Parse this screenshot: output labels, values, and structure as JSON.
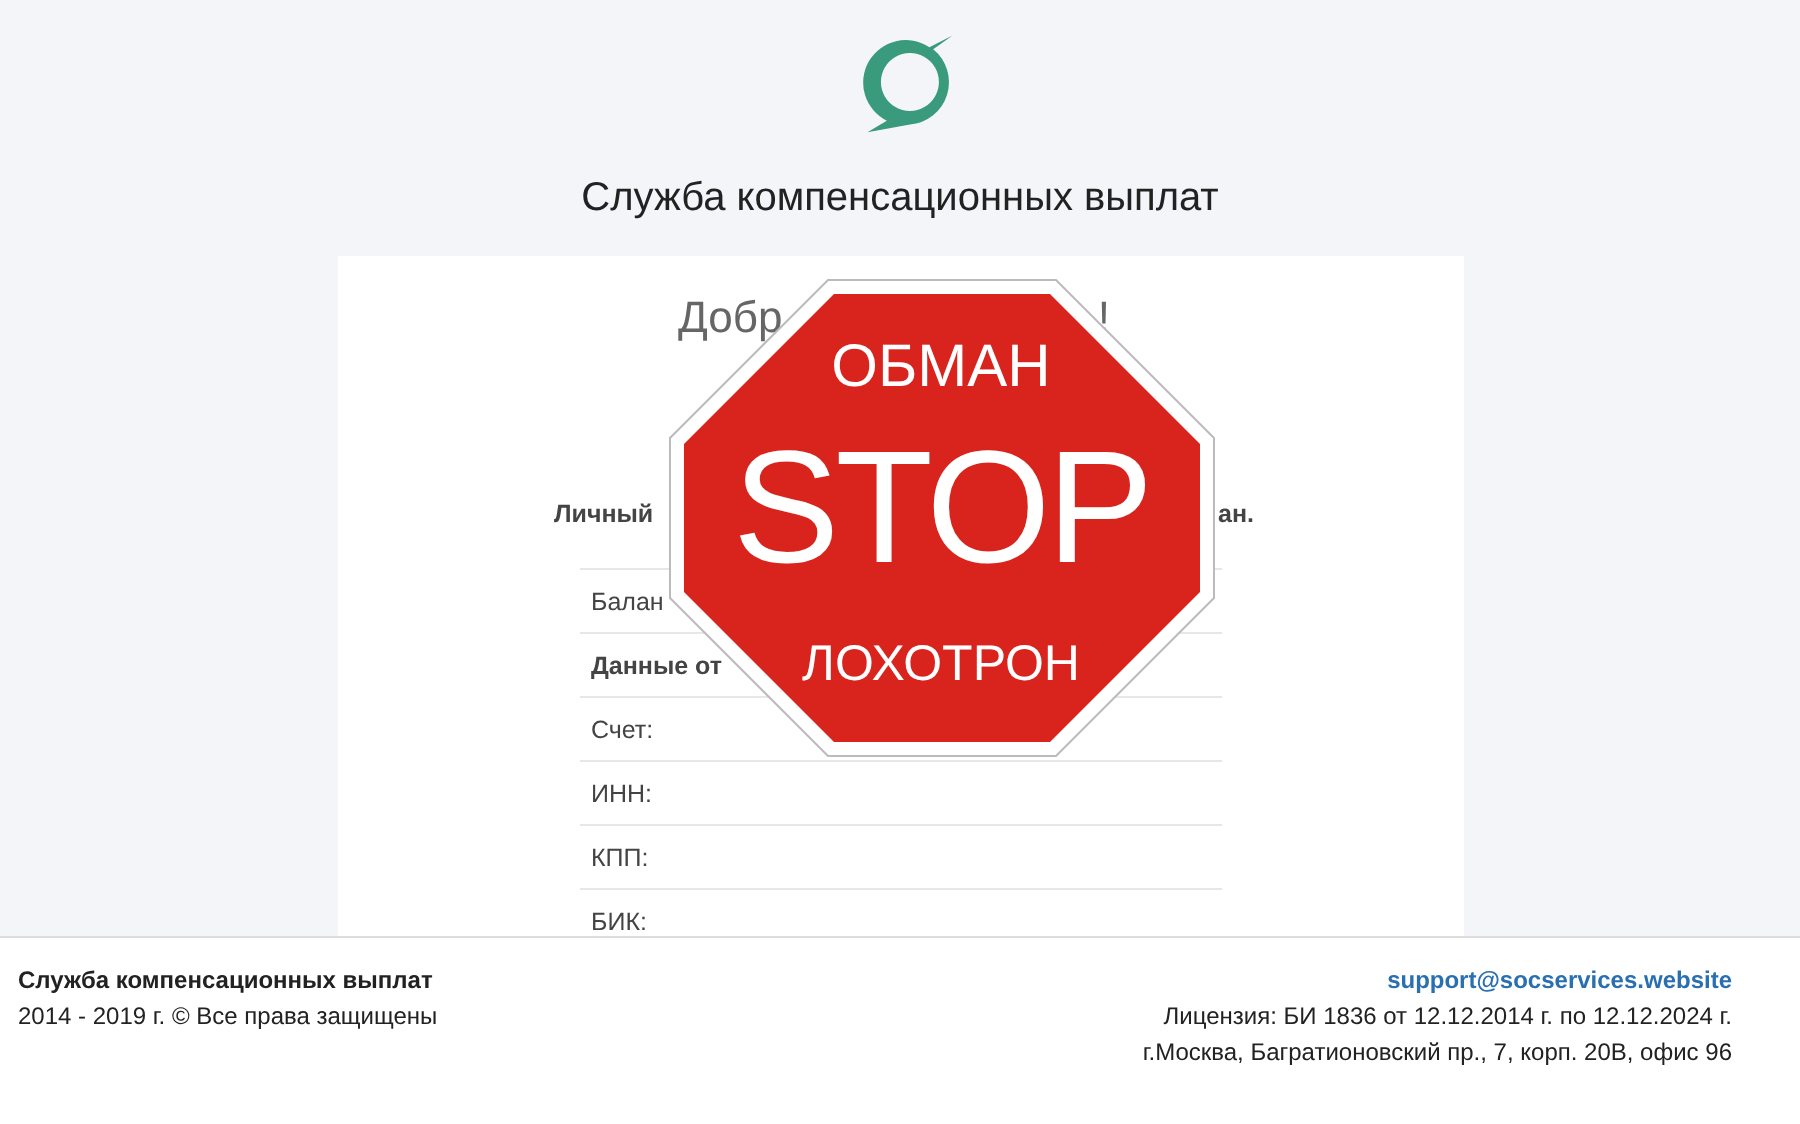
{
  "header": {
    "title": "Служба компенсационных выплат"
  },
  "card": {
    "heading_start": "Добр",
    "heading_end": "!",
    "subtitle_start": "Личный",
    "subtitle_end": "ан.",
    "rows": [
      {
        "label": "Балан",
        "kind": "plain"
      },
      {
        "label": "Данные от",
        "kind": "section"
      },
      {
        "label": "Счет:",
        "kind": "plain"
      },
      {
        "label": "ИНН:",
        "kind": "plain"
      },
      {
        "label": "КПП:",
        "kind": "plain"
      },
      {
        "label": "БИК:",
        "kind": "plain"
      }
    ]
  },
  "stop_sign": {
    "top": "ОБМАН",
    "middle": "STOP",
    "bottom": "ЛОХОТРОН"
  },
  "footer": {
    "name": "Служба компенсационных выплат",
    "copyright": "2014 - 2019 г. © Все права защищены",
    "email": "support@socservices.website",
    "license": "Лицензия: БИ 1836 от 12.12.2014 г. по 12.12.2024 г.",
    "address": "г.Москва, Багратионовский пр., 7, корп. 20В, офис 96"
  }
}
